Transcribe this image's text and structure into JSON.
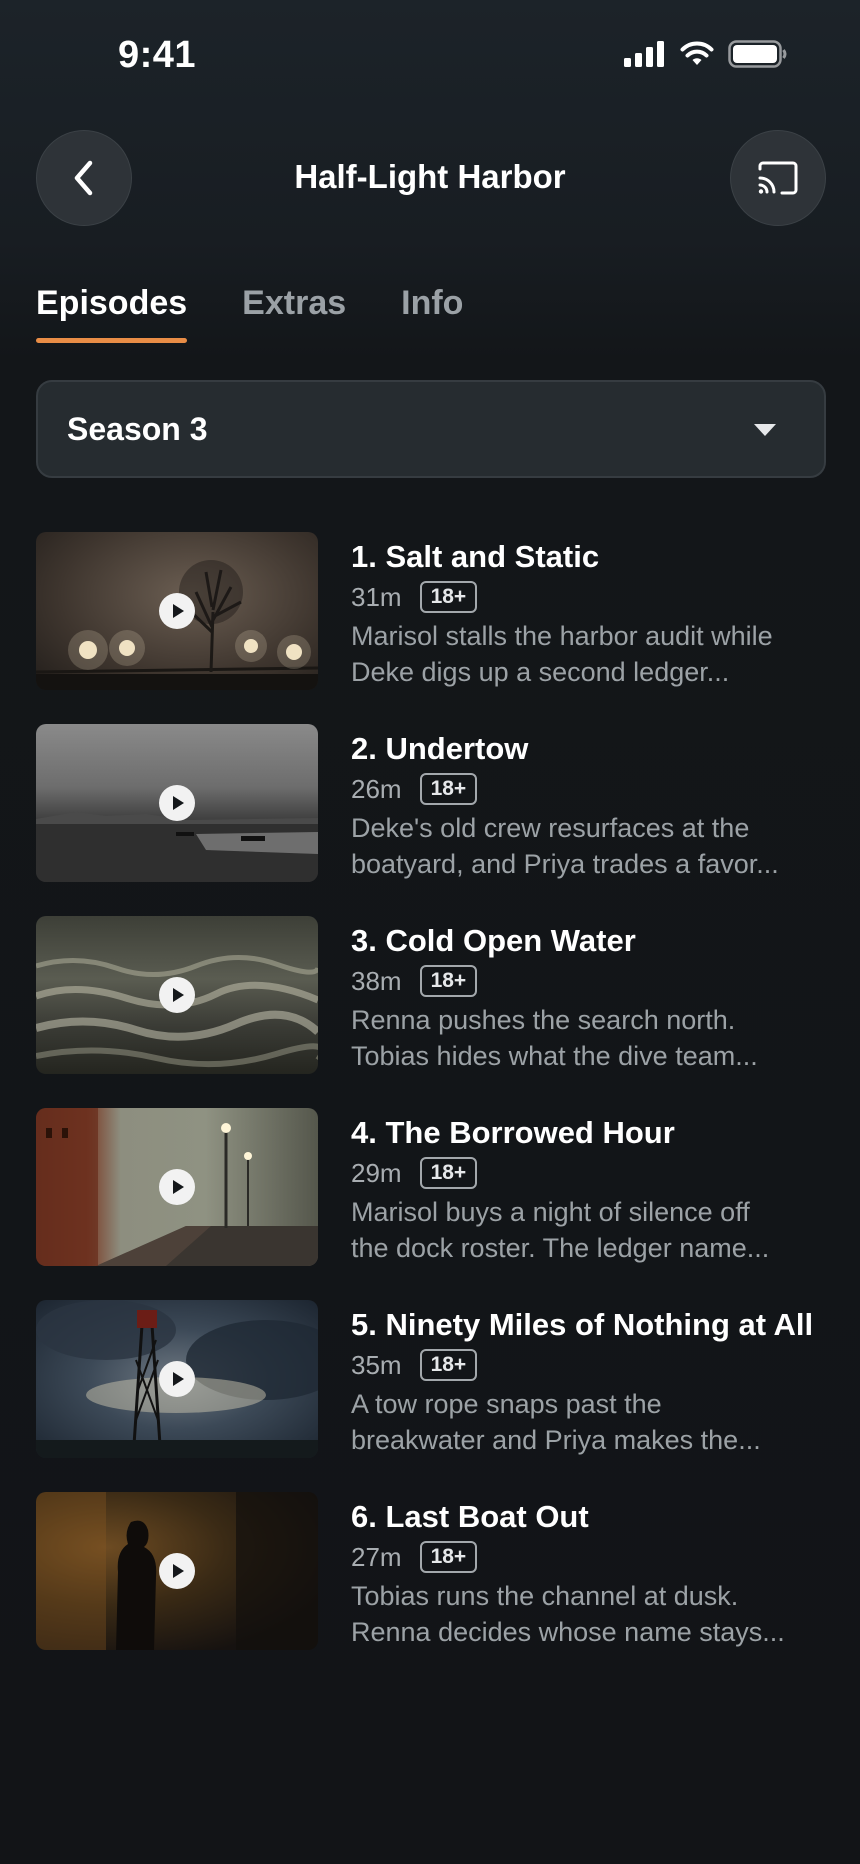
{
  "status_bar": {
    "time": "9:41"
  },
  "header": {
    "title": "Half-Light Harbor",
    "back_icon": "chevron-left-icon",
    "cast_icon": "cast-icon"
  },
  "tabs": [
    {
      "label": "Episodes",
      "active": true
    },
    {
      "label": "Extras",
      "active": false
    },
    {
      "label": "Info",
      "active": false
    }
  ],
  "season_selector": {
    "selected": "Season 3"
  },
  "colors": {
    "accent": "#e98d46",
    "background": "#121417",
    "card": "#262c30"
  },
  "episodes": [
    {
      "title": "1. Salt and Static",
      "duration": "31m",
      "rating": "18+",
      "desc_line1": "Marisol stalls the harbor audit while",
      "desc_line2": "Deke digs up a second ledger..."
    },
    {
      "title": "2. Undertow",
      "duration": "26m",
      "rating": "18+",
      "desc_line1": "Deke's old crew resurfaces at the",
      "desc_line2": "boatyard, and Priya trades a favor..."
    },
    {
      "title": "3. Cold Open Water",
      "duration": "38m",
      "rating": "18+",
      "desc_line1": "Renna pushes the search north.",
      "desc_line2": "Tobias hides what the dive team..."
    },
    {
      "title": "4. The Borrowed Hour",
      "duration": "29m",
      "rating": "18+",
      "desc_line1": "Marisol buys a night of silence off",
      "desc_line2": "the dock roster. The ledger name..."
    },
    {
      "title": "5. Ninety Miles of Nothing at All",
      "duration": "35m",
      "rating": "18+",
      "desc_line1": "A tow rope snaps past the",
      "desc_line2": "breakwater and Priya makes the..."
    },
    {
      "title": "6. Last Boat Out",
      "duration": "27m",
      "rating": "18+",
      "desc_line1": "Tobias runs the channel at dusk.",
      "desc_line2": "Renna decides whose name stays..."
    }
  ]
}
